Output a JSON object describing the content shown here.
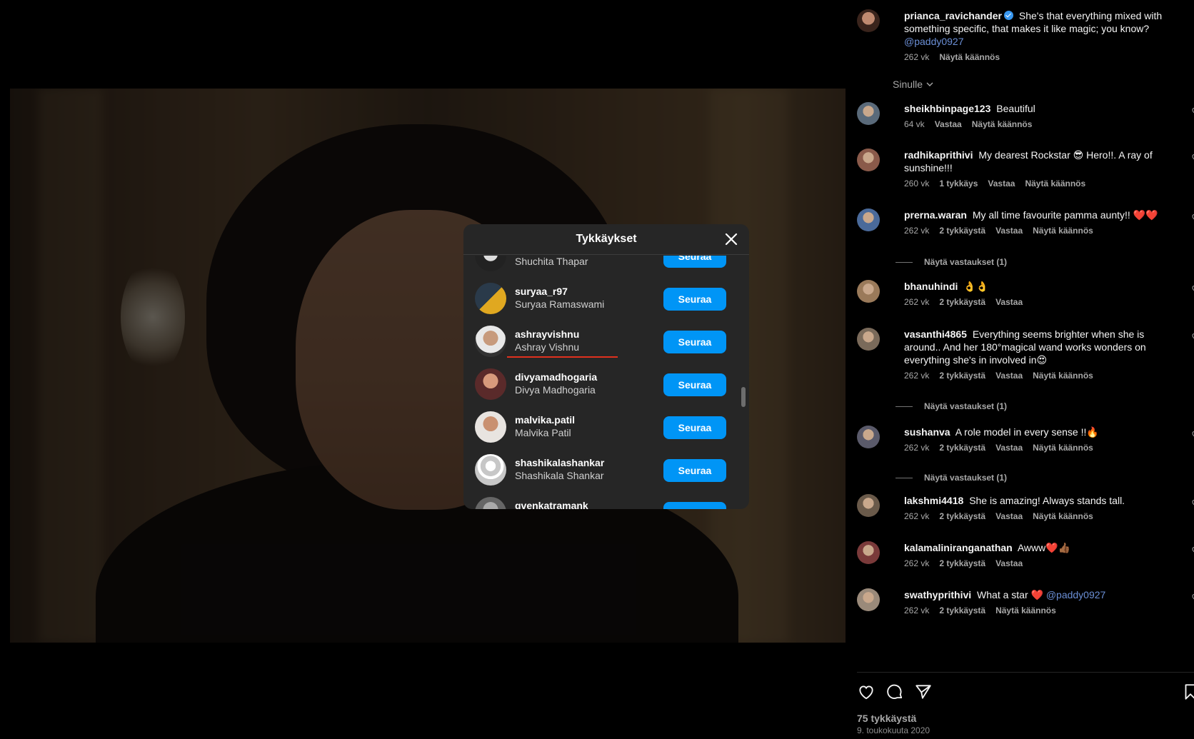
{
  "post": {
    "author": "prianca_ravichander",
    "caption": "She's that everything mixed with something specific, that makes it like magic; you know?",
    "caption_mention": "@paddy0927",
    "age": "262 vk",
    "see_translation": "Näytä käännös",
    "sort_label": "Sinulle",
    "likes_count": "75 tykkäystä",
    "date": "9. toukokuuta 2020"
  },
  "comments": [
    {
      "user": "sheikhbinpage123",
      "text": "Beautiful",
      "meta": [
        "64 vk",
        "Vastaa",
        "Näytä käännös"
      ]
    },
    {
      "user": "radhikaprithivi",
      "text": "My dearest Rockstar 😎 Hero!!. A ray of sunshine!!!",
      "meta": [
        "260 vk",
        "1 tykkäys",
        "Vastaa",
        "Näytä käännös"
      ]
    },
    {
      "user": "prerna.waran",
      "text": "My all time favourite pamma aunty!! ❤️❤️",
      "meta": [
        "262 vk",
        "2 tykkäystä",
        "Vastaa",
        "Näytä käännös"
      ],
      "replies": "Näytä vastaukset (1)"
    },
    {
      "user": "bhanuhindi",
      "text": "👌👌",
      "meta": [
        "262 vk",
        "2 tykkäystä",
        "Vastaa"
      ]
    },
    {
      "user": "vasanthi4865",
      "text": "Everything seems brighter when she is around.. And her 180°magical wand works wonders on everything she's in involved in😍",
      "meta": [
        "262 vk",
        "2 tykkäystä",
        "Vastaa",
        "Näytä käännös"
      ],
      "replies": "Näytä vastaukset (1)"
    },
    {
      "user": "sushanva",
      "text": "A role model in every sense !!🔥",
      "meta": [
        "262 vk",
        "2 tykkäystä",
        "Vastaa",
        "Näytä käännös"
      ],
      "replies": "Näytä vastaukset (1)"
    },
    {
      "user": "lakshmi4418",
      "text": "She is amazing! Always stands tall.",
      "meta": [
        "262 vk",
        "2 tykkäystä",
        "Vastaa",
        "Näytä käännös"
      ]
    },
    {
      "user": "kalamaliniranganathan",
      "text": "Awww❤️👍🏾",
      "meta": [
        "262 vk",
        "2 tykkäystä",
        "Vastaa"
      ]
    },
    {
      "user": "swathyprithivi",
      "text": "What a star ❤️",
      "mention": "@paddy0927",
      "meta": [
        "262 vk",
        "2 tykkäystä",
        "Näytä käännös"
      ]
    }
  ],
  "modal": {
    "title": "Tykkäykset",
    "follow_label": "Seuraa",
    "users": [
      {
        "handle": "",
        "name": "Shuchita Thapar"
      },
      {
        "handle": "suryaa_r97",
        "name": "Suryaa Ramaswami"
      },
      {
        "handle": "ashrayvishnu",
        "name": "Ashray Vishnu"
      },
      {
        "handle": "divyamadhogaria",
        "name": "Divya Madhogaria"
      },
      {
        "handle": "malvika.patil",
        "name": "Malvika Patil"
      },
      {
        "handle": "shashikalashankar",
        "name": "Shashikala Shankar"
      },
      {
        "handle": "gvenkatramank",
        "name": ""
      }
    ]
  },
  "colors": {
    "accent": "#0095f6",
    "mention": "#6b8fd6",
    "modal_bg": "#262626",
    "underline": "#e0301e"
  },
  "icons": [
    "heart-icon",
    "comment-icon",
    "share-icon",
    "bookmark-icon",
    "close-icon",
    "verified-badge-icon",
    "chevron-down-icon"
  ]
}
